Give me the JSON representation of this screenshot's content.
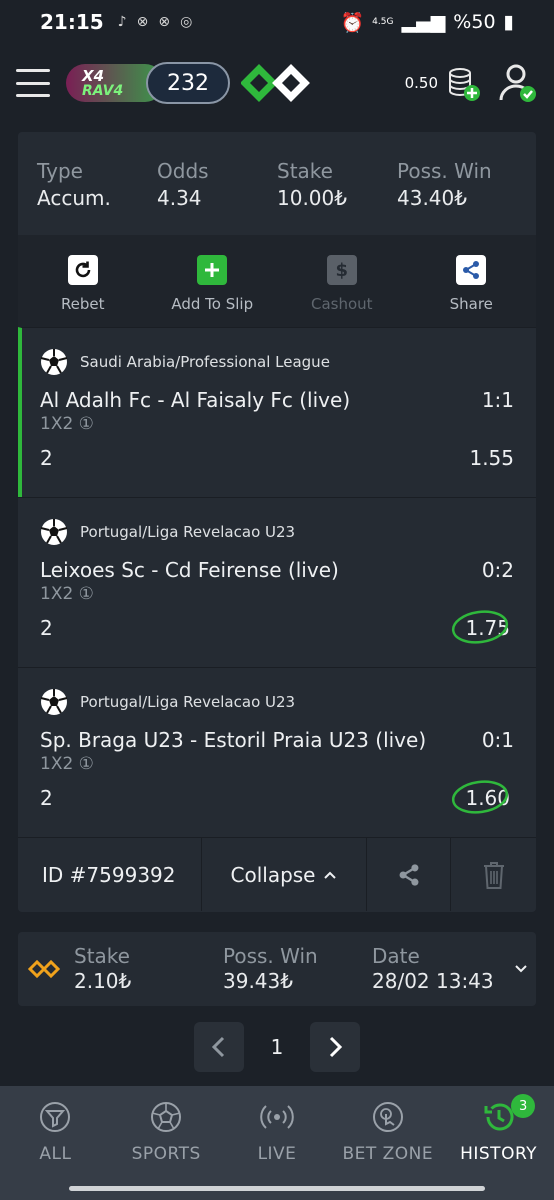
{
  "status_bar": {
    "time": "21:15",
    "network": "4.5G",
    "battery": "%50"
  },
  "header": {
    "promo_top": "X4",
    "promo_bottom": "RAV4",
    "promo_count": "232",
    "balance": "0.50"
  },
  "summary": {
    "type_label": "Type",
    "type_value": "Accum.",
    "odds_label": "Odds",
    "odds_value": "4.34",
    "stake_label": "Stake",
    "stake_value": "10.00₺",
    "win_label": "Poss. Win",
    "win_value": "43.40₺"
  },
  "actions": {
    "rebet": "Rebet",
    "add_to_slip": "Add To Slip",
    "cashout": "Cashout",
    "share": "Share"
  },
  "legs": [
    {
      "league": "Saudi Arabia/Professional League",
      "match": "Al Adalh Fc - Al Faisaly Fc (live)",
      "score": "1:1",
      "market": "1X2 ①",
      "pick": "2",
      "odds": "1.55",
      "won": false
    },
    {
      "league": "Portugal/Liga Revelacao U23",
      "match": "Leixoes Sc - Cd Feirense (live)",
      "score": "0:2",
      "market": "1X2 ①",
      "pick": "2",
      "odds": "1.75",
      "won": true
    },
    {
      "league": "Portugal/Liga Revelacao U23",
      "match": "Sp. Braga U23 - Estoril Praia U23 (live)",
      "score": "0:1",
      "market": "1X2 ①",
      "pick": "2",
      "odds": "1.60",
      "won": true
    }
  ],
  "bet_footer": {
    "id": "ID #7599392",
    "collapse": "Collapse"
  },
  "bet2": {
    "stake_label": "Stake",
    "stake_value": "2.10₺",
    "win_label": "Poss. Win",
    "win_value": "39.43₺",
    "date_label": "Date",
    "date_value": "28/02 13:43"
  },
  "pagination": {
    "page": "1"
  },
  "nav": [
    {
      "label": "ALL",
      "icon": "filter-icon"
    },
    {
      "label": "SPORTS",
      "icon": "soccer-ball-icon"
    },
    {
      "label": "LIVE",
      "icon": "broadcast-icon"
    },
    {
      "label": "BET ZONE",
      "icon": "touch-icon"
    },
    {
      "label": "HISTORY",
      "icon": "history-icon",
      "badge": "3"
    }
  ],
  "colors": {
    "accent": "#2fb83c",
    "background": "#1c2128",
    "card": "#252b33"
  }
}
